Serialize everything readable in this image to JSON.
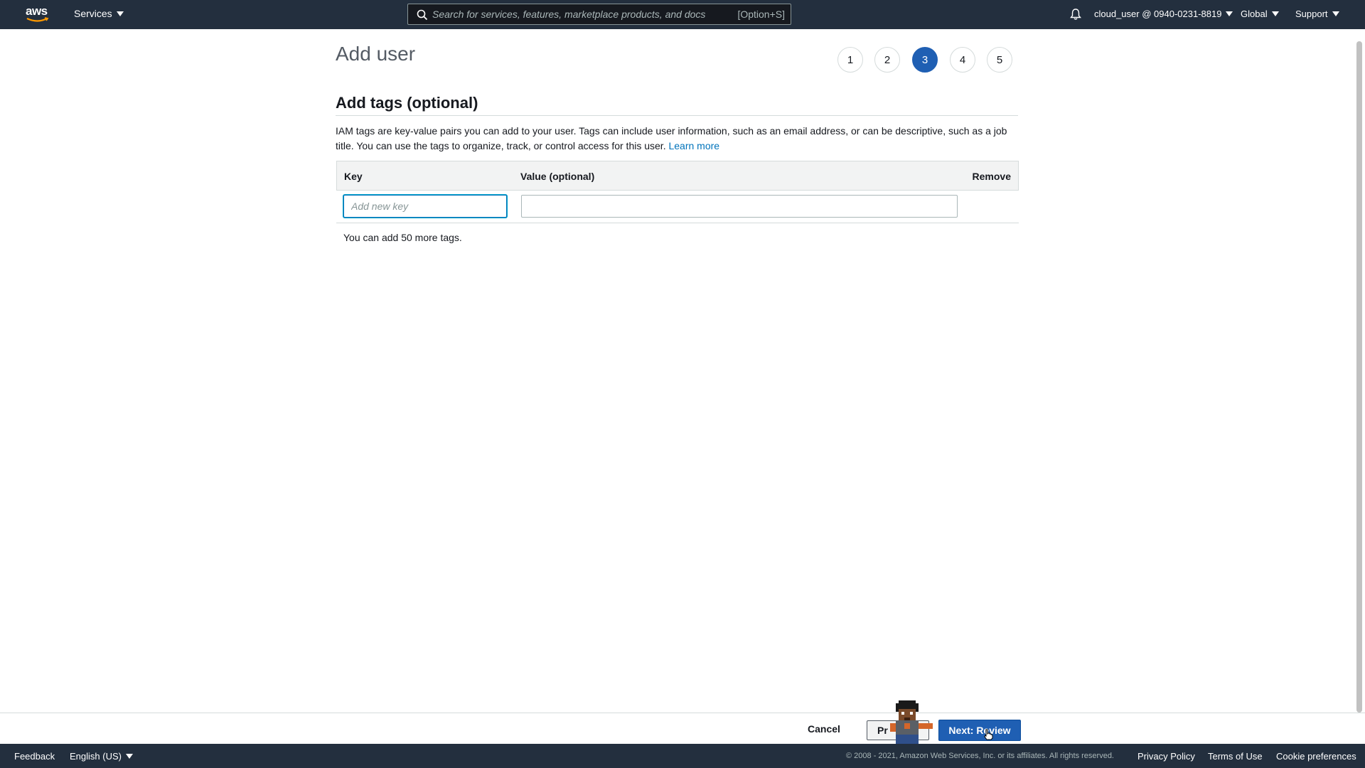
{
  "topnav": {
    "logo_text": "aws",
    "services_label": "Services",
    "search_placeholder": "Search for services, features, marketplace products, and docs",
    "search_shortcut": "[Option+S]",
    "account_label": "cloud_user @ 0940-0231-8819",
    "region_label": "Global",
    "support_label": "Support"
  },
  "page": {
    "title": "Add user",
    "steps": [
      "1",
      "2",
      "3",
      "4",
      "5"
    ],
    "active_step": 3
  },
  "tags_section": {
    "title": "Add tags (optional)",
    "description": "IAM tags are key-value pairs you can add to your user. Tags can include user information, such as an email address, or can be descriptive, such as a job title. You can use the tags to organize, track, or control access for this user.",
    "learn_more": "Learn more",
    "columns": {
      "key": "Key",
      "value": "Value (optional)",
      "remove": "Remove"
    },
    "key_placeholder": "Add new key",
    "key_value": "",
    "value_value": "",
    "remaining_text": "You can add 50 more tags."
  },
  "actions": {
    "cancel": "Cancel",
    "previous": "Pr",
    "next": "Next: Review"
  },
  "footer": {
    "feedback": "Feedback",
    "language": "English (US)",
    "copyright": "© 2008 - 2021, Amazon Web Services, Inc. or its affiliates. All rights reserved.",
    "privacy": "Privacy Policy",
    "terms": "Terms of Use",
    "cookies": "Cookie preferences"
  },
  "colors": {
    "nav_bg": "#232f3e",
    "primary_button": "#1f5fb3",
    "link": "#0073bb",
    "active_step": "#1f5fb3"
  }
}
